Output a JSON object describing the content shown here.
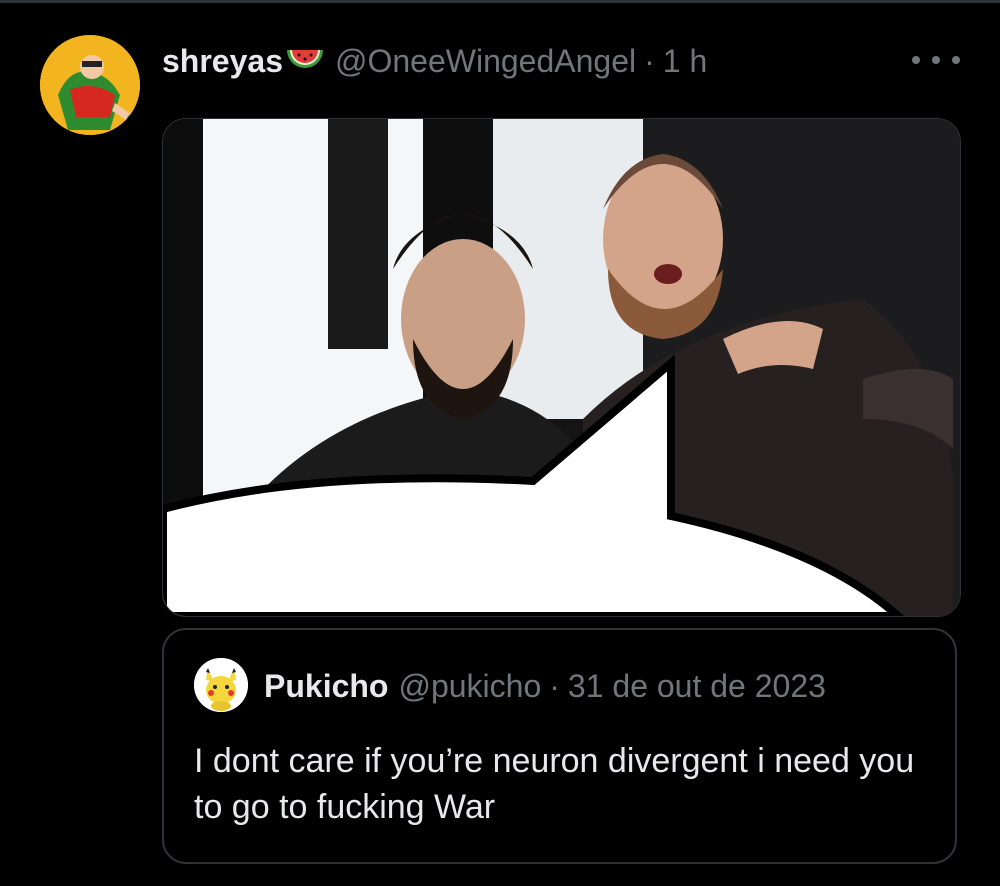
{
  "tweet": {
    "display_name": "shreyas",
    "name_emoji": "watermelon-emoji",
    "handle": "@OneeWingedAngel",
    "separator": "·",
    "time": "1 h",
    "more_icon": "more-horizontal-icon"
  },
  "media": {
    "subject": "two-wrestlers-with-speech-bubble"
  },
  "quoted": {
    "display_name": "Pukicho",
    "handle": "@pukicho",
    "separator": "·",
    "date": "31 de out de 2023",
    "text": "I dont care if you’re neuron divergent i need you to go to fucking War"
  },
  "colors": {
    "background": "#000000",
    "primary_text": "#e7e9ea",
    "secondary_text": "#71767b",
    "border": "#2f3336"
  }
}
